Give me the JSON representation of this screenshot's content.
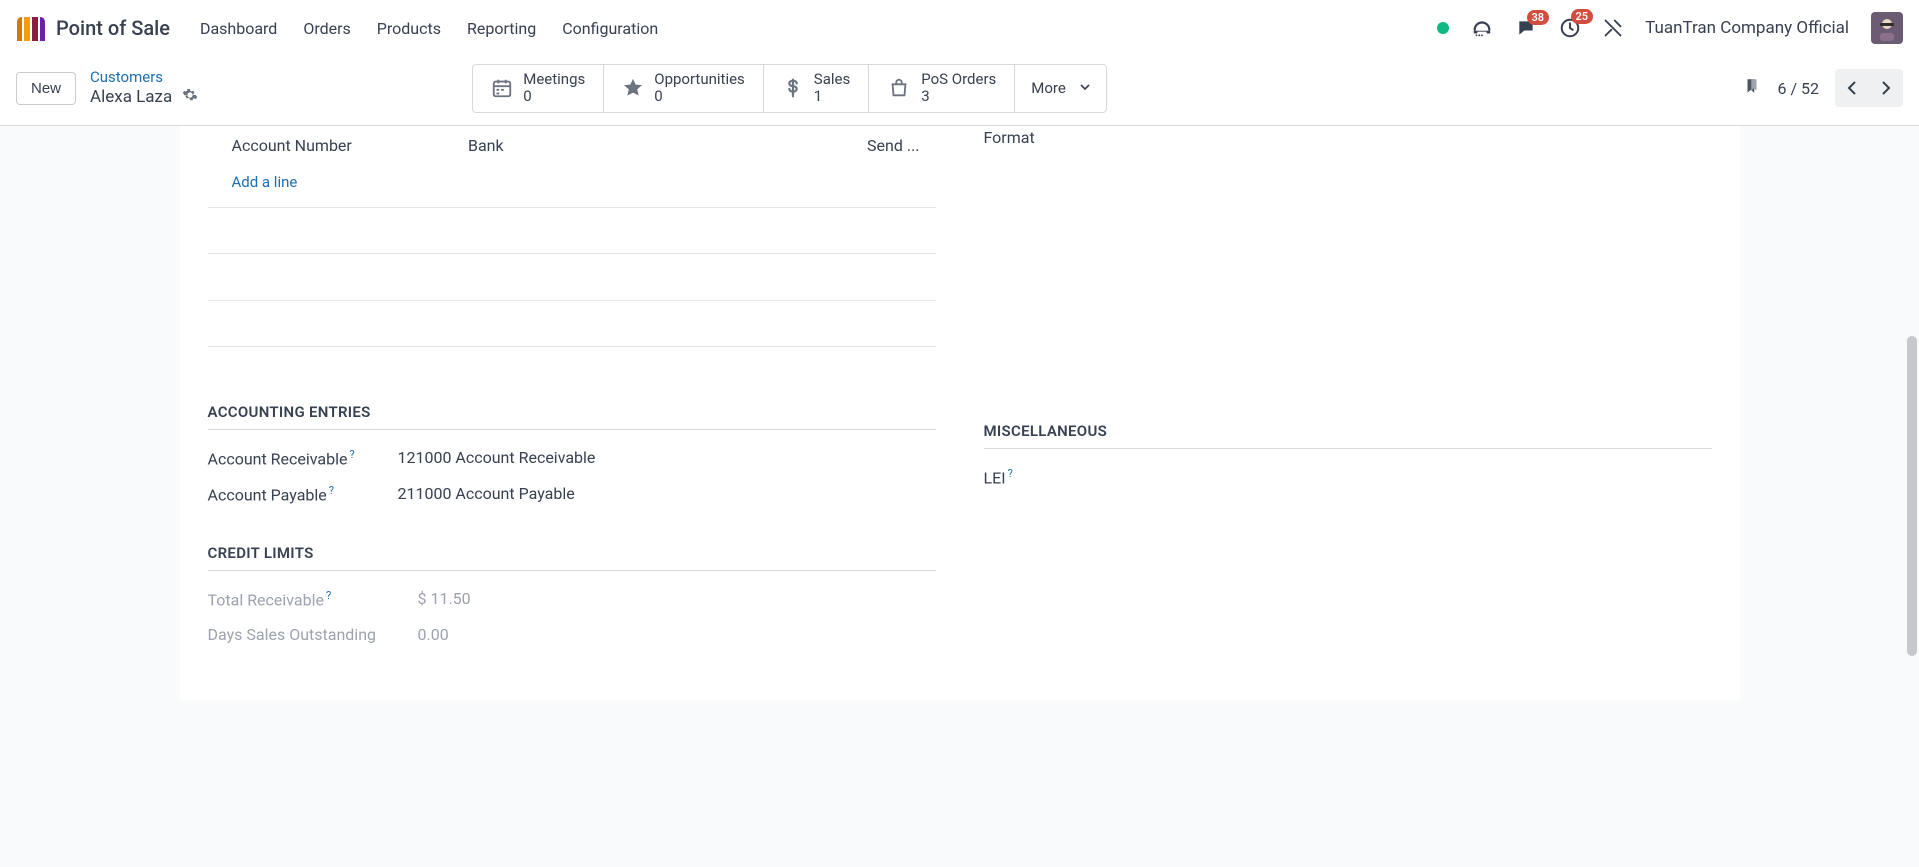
{
  "app": {
    "title": "Point of Sale"
  },
  "nav": {
    "dashboard": "Dashboard",
    "orders": "Orders",
    "products": "Products",
    "reporting": "Reporting",
    "configuration": "Configuration"
  },
  "topright": {
    "messages_badge": "38",
    "activities_badge": "25",
    "company": "TuanTran Company Official"
  },
  "controlbar": {
    "new": "New",
    "breadcrumb_parent": "Customers",
    "breadcrumb_current": "Alexa Laza"
  },
  "stats": {
    "meetings_label": "Meetings",
    "meetings_count": "0",
    "opportunities_label": "Opportunities",
    "opportunities_count": "0",
    "sales_label": "Sales",
    "sales_count": "1",
    "pos_label": "PoS Orders",
    "pos_count": "3",
    "more": "More"
  },
  "pager": {
    "text": "6 / 52"
  },
  "bank_table": {
    "col_account_number": "Account Number",
    "col_bank": "Bank",
    "col_send": "Send ...",
    "add_line": "Add a line"
  },
  "right_top": {
    "format": "Format"
  },
  "sections": {
    "accounting_entries": "ACCOUNTING ENTRIES",
    "credit_limits": "CREDIT LIMITS",
    "miscellaneous": "MISCELLANEOUS"
  },
  "acc_entries": {
    "receivable_label": "Account Receivable",
    "receivable_value": "121000 Account Receivable",
    "payable_label": "Account Payable",
    "payable_value": "211000 Account Payable"
  },
  "credit": {
    "total_receivable_label": "Total Receivable",
    "total_receivable_value": "$ 11.50",
    "dso_label": "Days Sales Outstanding",
    "dso_value": "0.00"
  },
  "misc": {
    "lei_label": "LEI"
  }
}
